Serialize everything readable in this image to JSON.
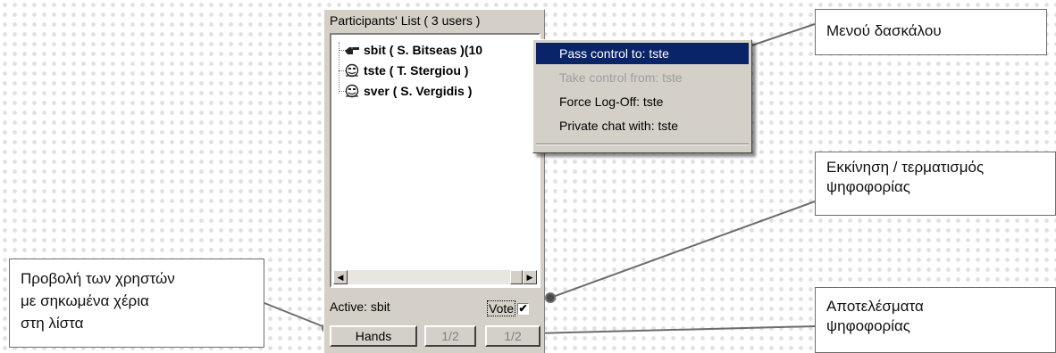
{
  "panel": {
    "title": "Participants' List ( 3 users )",
    "participants": [
      {
        "label": "sbit ( S. Bitseas )(10",
        "icon": "pointing-hand-icon"
      },
      {
        "label": "tste ( T. Stergiou )",
        "icon": "user-face-icon"
      },
      {
        "label": "sver ( S. Vergidis )",
        "icon": "user-face-icon"
      }
    ],
    "active_label": "Active: sbit",
    "vote_label": "Vote",
    "vote_checked": "✔",
    "buttons": {
      "hands": "Hands",
      "count1": "1/2",
      "count2": "1/2"
    }
  },
  "context_menu": {
    "items": [
      {
        "label": "Pass control to: tste",
        "state": "selected"
      },
      {
        "label": "Take control from: tste",
        "state": "disabled"
      },
      {
        "label": "Force Log-Off: tste",
        "state": "normal"
      },
      {
        "label": "Private chat with: tste",
        "state": "normal"
      }
    ]
  },
  "callouts": {
    "teacher_menu": "Μενού δασκάλου",
    "vote_start_line1": "Εκκίνηση / τερματισμός",
    "vote_start_line2": "ψηφοφορίας",
    "hands_line1": "Προβολή των χρηστών",
    "hands_line2": "με σηκωμένα χέρια",
    "hands_line3": "στη λίστα",
    "results_line1": "Αποτελέσματα",
    "results_line2": "ψηφοφορίας"
  },
  "colors": {
    "menu_highlight": "#0a246a",
    "window_face": "#d4d0c8",
    "leader_line": "#6c6c6c"
  }
}
